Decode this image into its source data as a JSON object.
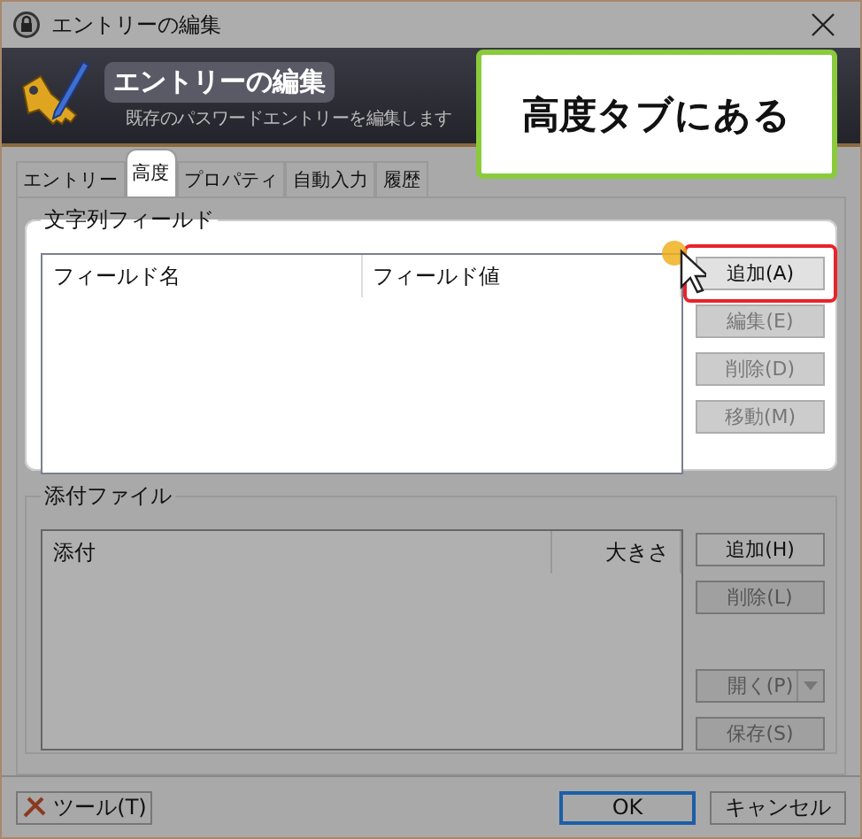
{
  "window": {
    "title": "エントリーの編集"
  },
  "header": {
    "title": "エントリーの編集",
    "subtitle": "既存のパスワードエントリーを編集します"
  },
  "callout": {
    "text": "高度タブにある"
  },
  "tabs": [
    {
      "label": "エントリー",
      "selected": false
    },
    {
      "label": "高度",
      "selected": true
    },
    {
      "label": "プロパティ",
      "selected": false
    },
    {
      "label": "自動入力",
      "selected": false
    },
    {
      "label": "履歴",
      "selected": false
    }
  ],
  "groups": [
    {
      "title": "文字列フィールド",
      "spotlight": true,
      "columns": [
        {
          "label": "フィールド名",
          "kind": "text"
        },
        {
          "label": "フィールド値",
          "kind": "text"
        }
      ],
      "buttons": [
        {
          "label": "追加(A)",
          "kind": "plain",
          "disabled": false,
          "highlighted": true
        },
        {
          "label": "編集(E)",
          "kind": "plain",
          "disabled": true,
          "highlighted": false
        },
        {
          "label": "削除(D)",
          "kind": "plain",
          "disabled": true,
          "highlighted": false
        },
        {
          "label": "移動(M)",
          "kind": "plain",
          "disabled": true,
          "highlighted": false
        }
      ]
    },
    {
      "title": "添付ファイル",
      "spotlight": false,
      "columns": [
        {
          "label": "添付",
          "kind": "text"
        },
        {
          "label": "大きさ",
          "kind": "numeric"
        }
      ],
      "buttons": [
        {
          "label": "追加(H)",
          "kind": "plain",
          "disabled": false,
          "highlighted": false
        },
        {
          "label": "削除(L)",
          "kind": "plain",
          "disabled": true,
          "highlighted": false
        },
        {
          "label": "開く(P)",
          "kind": "dropdown",
          "disabled": true,
          "highlighted": false
        },
        {
          "label": "保存(S)",
          "kind": "plain",
          "disabled": true,
          "highlighted": false
        }
      ]
    }
  ],
  "footer": {
    "tools_button": "ツール(T)",
    "ok_button": "OK",
    "cancel_button": "キャンセル"
  }
}
